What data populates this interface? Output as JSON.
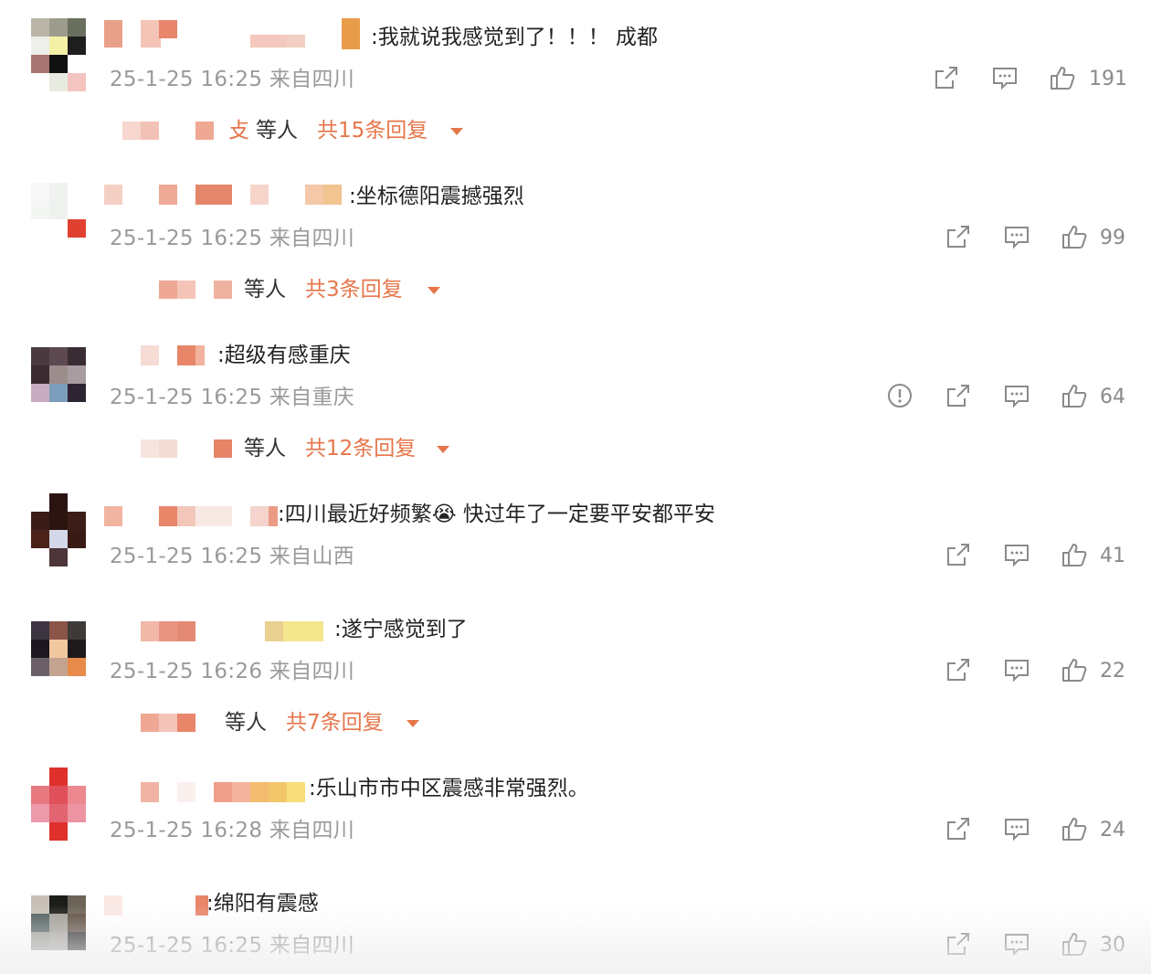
{
  "comments": [
    {
      "text": ":我就说我感觉到了！！！ 成都",
      "meta": "25-1-25 16:25 来自四川",
      "likes": "191",
      "reply_tail": "等人",
      "reply_count": "共15条回复",
      "report": false
    },
    {
      "text": ":坐标德阳震撼强烈",
      "meta": "25-1-25 16:25 来自四川",
      "likes": "99",
      "reply_tail": "等人",
      "reply_count": "共3条回复",
      "report": false
    },
    {
      "text": ":超级有感重庆",
      "meta": "25-1-25 16:25 来自重庆",
      "likes": "64",
      "reply_tail": "等人",
      "reply_count": "共12条回复",
      "report": true
    },
    {
      "text": ":四川最近好频繁😭 快过年了一定要平安都平安",
      "meta": "25-1-25 16:25 来自山西",
      "likes": "41",
      "report": false
    },
    {
      "text": ":遂宁感觉到了",
      "meta": "25-1-25 16:26 来自四川",
      "likes": "22",
      "reply_tail": "等人",
      "reply_count": "共7条回复",
      "report": false
    },
    {
      "text": ":乐山市市中区震感非常强烈。",
      "meta": "25-1-25 16:28 来自四川",
      "likes": "24",
      "report": false
    },
    {
      "text": ":绵阳有震感",
      "meta": "25-1-25 16:25 来自四川",
      "likes": "30",
      "report": false
    }
  ],
  "reply_prefix_fragments": [
    "攴"
  ],
  "colors": {
    "accent": "#e6764a",
    "meta": "#9a9a9a",
    "text": "#222222",
    "icon": "#8a8a8a"
  },
  "icons": [
    "share-icon",
    "comment-icon",
    "like-icon",
    "report-icon",
    "caret-down-icon"
  ]
}
